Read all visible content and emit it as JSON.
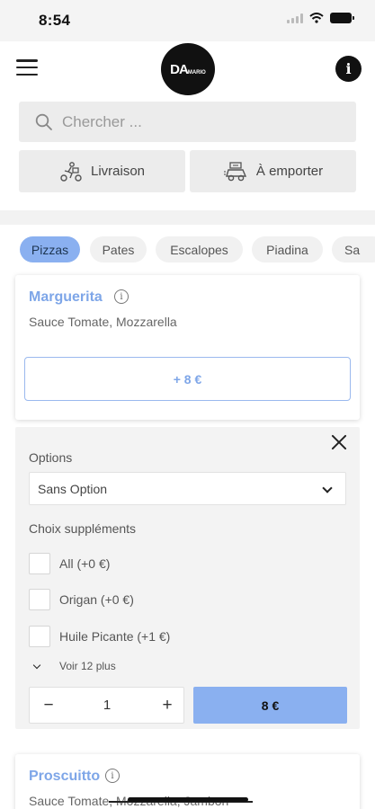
{
  "status_bar": {
    "time": "8:54"
  },
  "header": {
    "logo_text": "DA",
    "logo_sub": "MARIO"
  },
  "search": {
    "placeholder": "Chercher ..."
  },
  "modes": {
    "delivery": "Livraison",
    "takeaway": "À emporter"
  },
  "categories": [
    "Pizzas",
    "Pates",
    "Escalopes",
    "Piadina",
    "Sa"
  ],
  "active_category": "Pizzas",
  "products": [
    {
      "name": "Marguerita",
      "description": "Sauce Tomate, Mozzarella",
      "add_label": "+ 8 €"
    },
    {
      "name": "Proscuitto",
      "description": "Sauce Tomate, Mozzarella, Jambon"
    }
  ],
  "options_panel": {
    "options_label": "Options",
    "selected_option": "Sans Option",
    "extras_label": "Choix suppléments",
    "extras": [
      {
        "label": "All (+0 €)",
        "checked": false
      },
      {
        "label": "Origan (+0 €)",
        "checked": false
      },
      {
        "label": "Huile Picante (+1 €)",
        "checked": false
      }
    ],
    "more_label": "Voir 12 plus",
    "quantity": "1",
    "minus": "−",
    "plus": "+",
    "confirm_label": "8 €"
  },
  "colors": {
    "accent": "#8ab0f0",
    "accent_text": "#7ea6e8",
    "panel_bg": "#f3f3f3"
  }
}
